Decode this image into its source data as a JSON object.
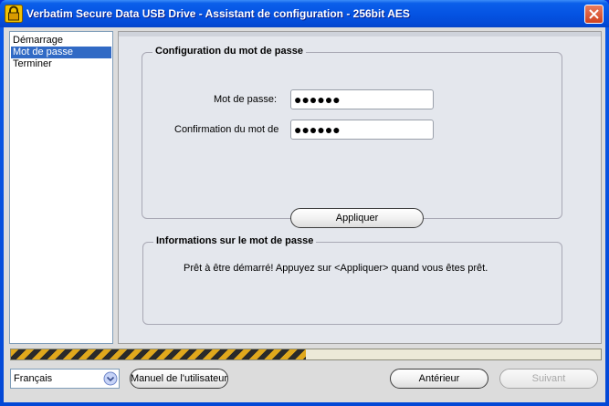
{
  "window": {
    "title": "Verbatim Secure Data USB Drive - Assistant de configuration - 256bit AES"
  },
  "nav": {
    "items": [
      {
        "label": "Démarrage"
      },
      {
        "label": "Mot de passe"
      },
      {
        "label": "Terminer"
      }
    ]
  },
  "password_group": {
    "title": "Configuration du mot de passe",
    "password_label": "Mot de passe:",
    "password_value": "●●●●●●",
    "confirm_label": "Confirmation du mot de",
    "confirm_value": "●●●●●●",
    "apply_label": "Appliquer"
  },
  "info_group": {
    "title": "Informations sur le mot de passe",
    "message": "Prêt à être démarré! Appuyez sur <Appliquer> quand vous êtes prêt."
  },
  "progress": {
    "value": 0.5
  },
  "footer": {
    "language": "Français",
    "manual_label": "Manuel de l'utilisateur",
    "previous_label": "Antérieur",
    "next_label": "Suivant"
  },
  "colors": {
    "title_bar": "#0554e3",
    "selection": "#316ac5",
    "progress_stripe": "#e0a81c"
  }
}
